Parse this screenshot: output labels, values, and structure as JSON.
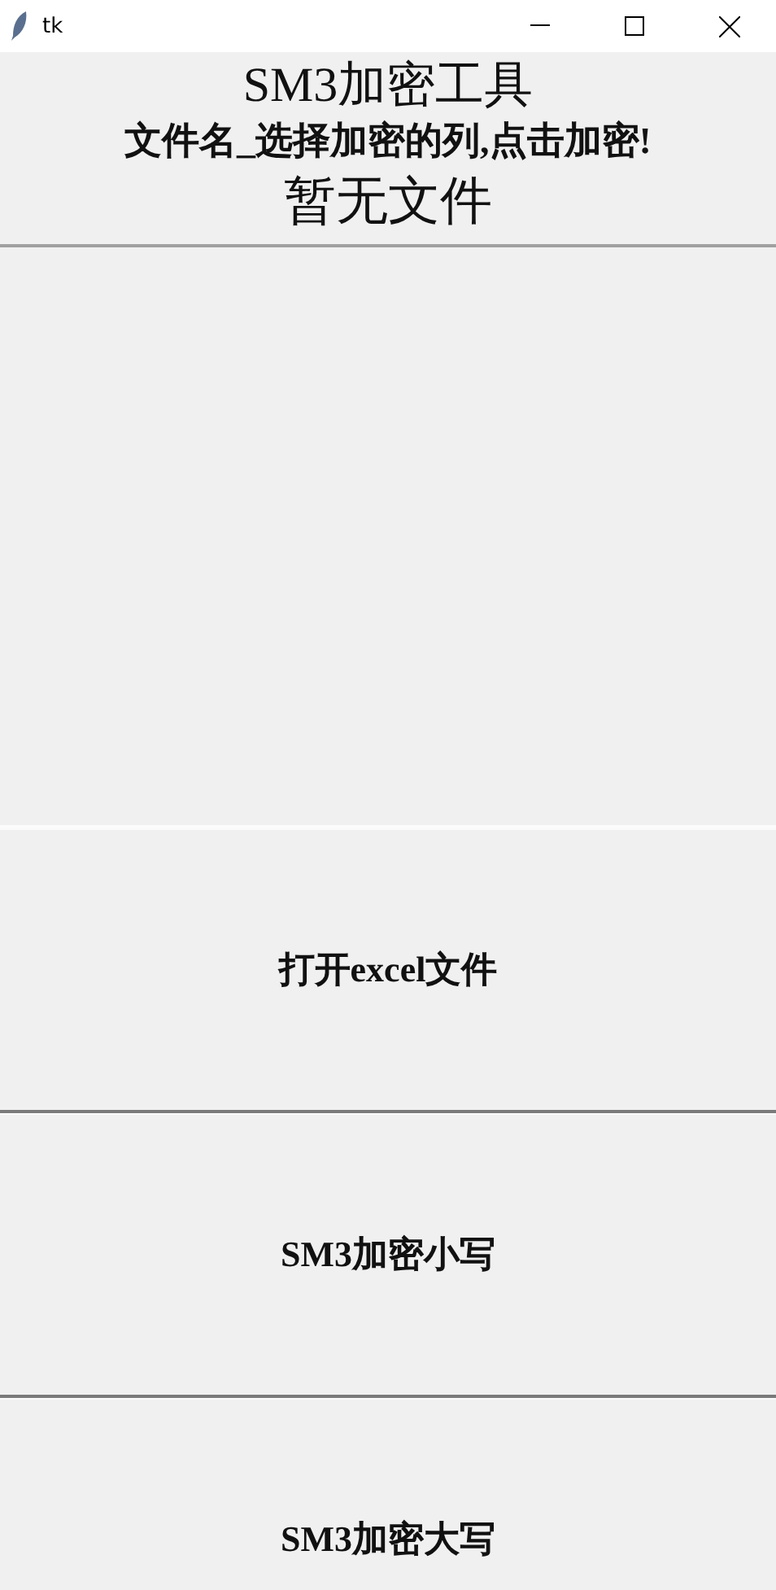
{
  "window": {
    "title": "tk"
  },
  "header": {
    "title": "SM3加密工具",
    "hint": "文件名_选择加密的列,点击加密!",
    "file_status": "暂无文件"
  },
  "buttons": [
    {
      "label": "打开excel文件"
    },
    {
      "label": "SM3加密小写"
    },
    {
      "label": "SM3加密大写"
    }
  ]
}
